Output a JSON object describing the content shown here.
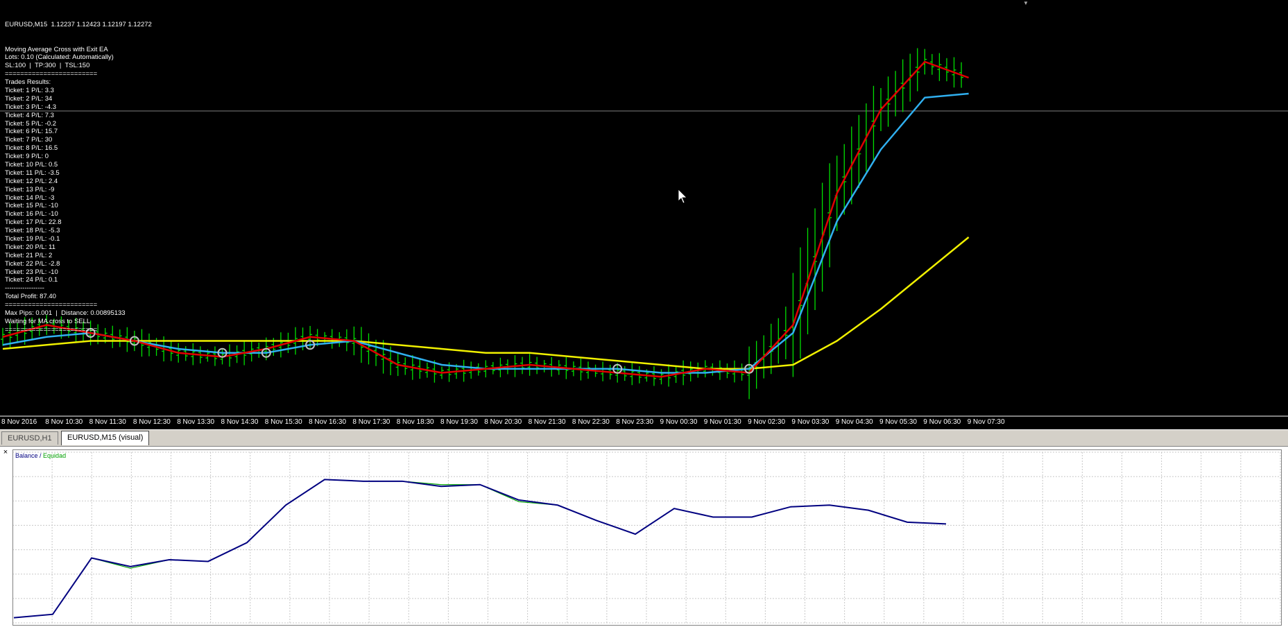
{
  "window": {
    "symbol_header": "EURUSD,M15  1.12237 1.12423 1.12197 1.12272"
  },
  "overlay": {
    "lines": [
      "Moving Average Cross with Exit EA",
      "Lots: 0.10 (Calculated: Automatically)",
      "SL:100  |  TP:300  |  TSL:150",
      "========================",
      "Trades Results:",
      "Ticket: 1 P/L: 3.3",
      "Ticket: 2 P/L: 34",
      "Ticket: 3 P/L: -4.3",
      "Ticket: 4 P/L: 7.3",
      "Ticket: 5 P/L: -0.2",
      "Ticket: 6 P/L: 15.7",
      "Ticket: 7 P/L: 30",
      "Ticket: 8 P/L: 16.5",
      "Ticket: 9 P/L: 0",
      "Ticket: 10 P/L: 0.5",
      "Ticket: 11 P/L: -3.5",
      "Ticket: 12 P/L: 2.4",
      "Ticket: 13 P/L: -9",
      "Ticket: 14 P/L: -3",
      "Ticket: 15 P/L: -10",
      "Ticket: 16 P/L: -10",
      "Ticket: 17 P/L: 22.8",
      "Ticket: 18 P/L: -5.3",
      "Ticket: 19 P/L: -0.1",
      "Ticket: 20 P/L: 11",
      "Ticket: 21 P/L: 2",
      "Ticket: 22 P/L: -2.8",
      "Ticket: 23 P/L: -10",
      "Ticket: 24 P/L: 0.1",
      "------------------",
      "Total Profit: 87.40",
      "========================",
      "Max Pips: 0.001  |  Distance: 0.00895133",
      "Waiting for MA cross to SELL",
      "========================"
    ]
  },
  "time_axis": {
    "labels": [
      "8 Nov 2016",
      "8 Nov 10:30",
      "8 Nov 11:30",
      "8 Nov 12:30",
      "8 Nov 13:30",
      "8 Nov 14:30",
      "8 Nov 15:30",
      "8 Nov 16:30",
      "8 Nov 17:30",
      "8 Nov 18:30",
      "8 Nov 19:30",
      "8 Nov 20:30",
      "8 Nov 21:30",
      "8 Nov 22:30",
      "8 Nov 23:30",
      "9 Nov 00:30",
      "9 Nov 01:30",
      "9 Nov 02:30",
      "9 Nov 03:30",
      "9 Nov 04:30",
      "9 Nov 05:30",
      "9 Nov 06:30",
      "9 Nov 07:30"
    ]
  },
  "tabs": [
    {
      "label": "EURUSD,H1",
      "active": false
    },
    {
      "label": "EURUSD,M15 (visual)",
      "active": true
    }
  ],
  "tester": {
    "legend_balance": "Balance",
    "legend_sep": " / ",
    "legend_equity": "Equidad",
    "balance_color": "#000080",
    "equity_color": "#00a000"
  },
  "chart_data": [
    {
      "type": "line",
      "title": "EURUSD,M15  1.12237 1.12423 1.12197 1.12272",
      "x": [
        "8 Nov 2016",
        "8 Nov 10:30",
        "8 Nov 11:30",
        "8 Nov 12:30",
        "8 Nov 13:30",
        "8 Nov 14:30",
        "8 Nov 15:30",
        "8 Nov 16:30",
        "8 Nov 17:30",
        "8 Nov 18:30",
        "8 Nov 19:30",
        "8 Nov 20:30",
        "8 Nov 21:30",
        "8 Nov 22:30",
        "8 Nov 23:30",
        "9 Nov 00:30",
        "9 Nov 01:30",
        "9 Nov 02:30",
        "9 Nov 03:30",
        "9 Nov 04:30",
        "9 Nov 05:30",
        "9 Nov 06:30",
        "9 Nov 07:30"
      ],
      "ylim": [
        0,
        100
      ],
      "colors": {
        "bars": "#00e000",
        "fast_ma": "#e00000",
        "mid_ma": "#30b0f0",
        "slow_ma": "#f0f000"
      },
      "series": [
        {
          "values": [
            19,
            22,
            20,
            18,
            15,
            14,
            16,
            19,
            18,
            12,
            10,
            11,
            12,
            11,
            10,
            9,
            11,
            10,
            22,
            55,
            76,
            88,
            84
          ]
        },
        {
          "values": [
            17,
            19,
            20,
            18,
            16,
            15,
            15,
            17,
            18,
            15,
            12,
            11,
            11,
            11,
            11,
            10,
            10,
            11,
            20,
            48,
            66,
            79,
            80
          ]
        },
        {
          "values": [
            16,
            17,
            18,
            18,
            18,
            18,
            18,
            18,
            18,
            17,
            16,
            15,
            15,
            14,
            13,
            12,
            11,
            11,
            12,
            18,
            26,
            35,
            44
          ]
        }
      ]
    },
    {
      "type": "line",
      "xlabel": "",
      "ylabel": "",
      "x": [
        0,
        1,
        2,
        3,
        4,
        5,
        6,
        7,
        8,
        9,
        10,
        11,
        12,
        13,
        14,
        15,
        16,
        17,
        18,
        19,
        20,
        21,
        22,
        23,
        24
      ],
      "ylim": [
        0,
        100
      ],
      "series": [
        {
          "name": "Balance",
          "values": [
            3,
            5,
            38,
            33,
            37,
            36,
            47,
            69,
            84,
            83,
            83,
            80,
            81,
            72,
            69,
            60,
            52,
            67,
            62,
            62,
            68,
            69,
            66,
            59,
            58
          ]
        },
        {
          "name": "Equidad",
          "values": [
            3,
            5,
            38,
            32,
            37,
            36,
            47,
            69,
            84,
            83,
            83,
            81,
            81,
            71,
            69,
            60,
            52,
            67,
            62,
            62,
            68,
            69,
            66,
            59,
            58
          ]
        }
      ]
    }
  ]
}
